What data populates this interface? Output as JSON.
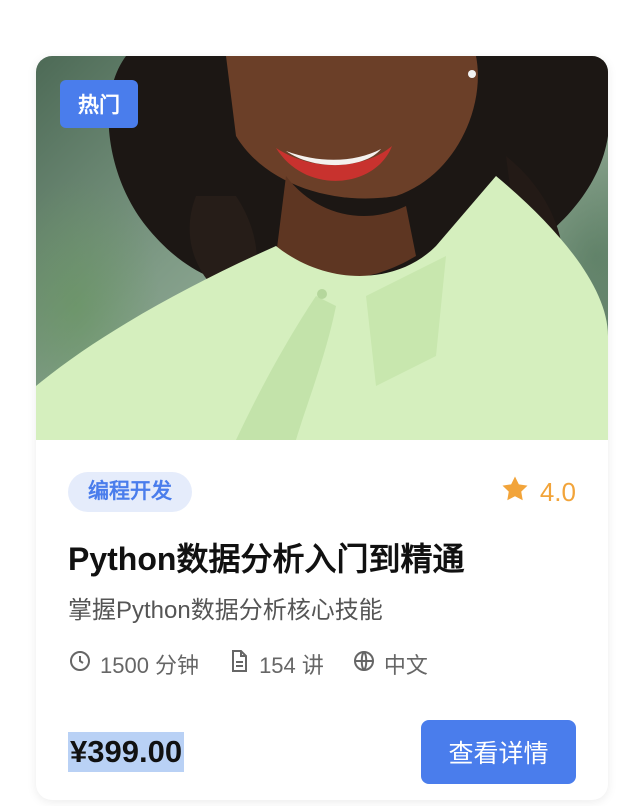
{
  "badge": {
    "label": "热门"
  },
  "course": {
    "category": "编程开发",
    "rating": "4.0",
    "title": "Python数据分析入门到精通",
    "subtitle": "掌握Python数据分析核心技能",
    "meta": {
      "duration": "1500 分钟",
      "lessons": "154 讲",
      "language": "中文"
    },
    "price": "¥399.00",
    "cta_label": "查看详情"
  },
  "icons": {
    "rating": "star-icon",
    "duration": "clock-icon",
    "lessons": "document-icon",
    "language": "globe-icon"
  },
  "colors": {
    "accent": "#4a7dec",
    "star": "#f2a43a",
    "category_bg": "#e5ecfb"
  }
}
